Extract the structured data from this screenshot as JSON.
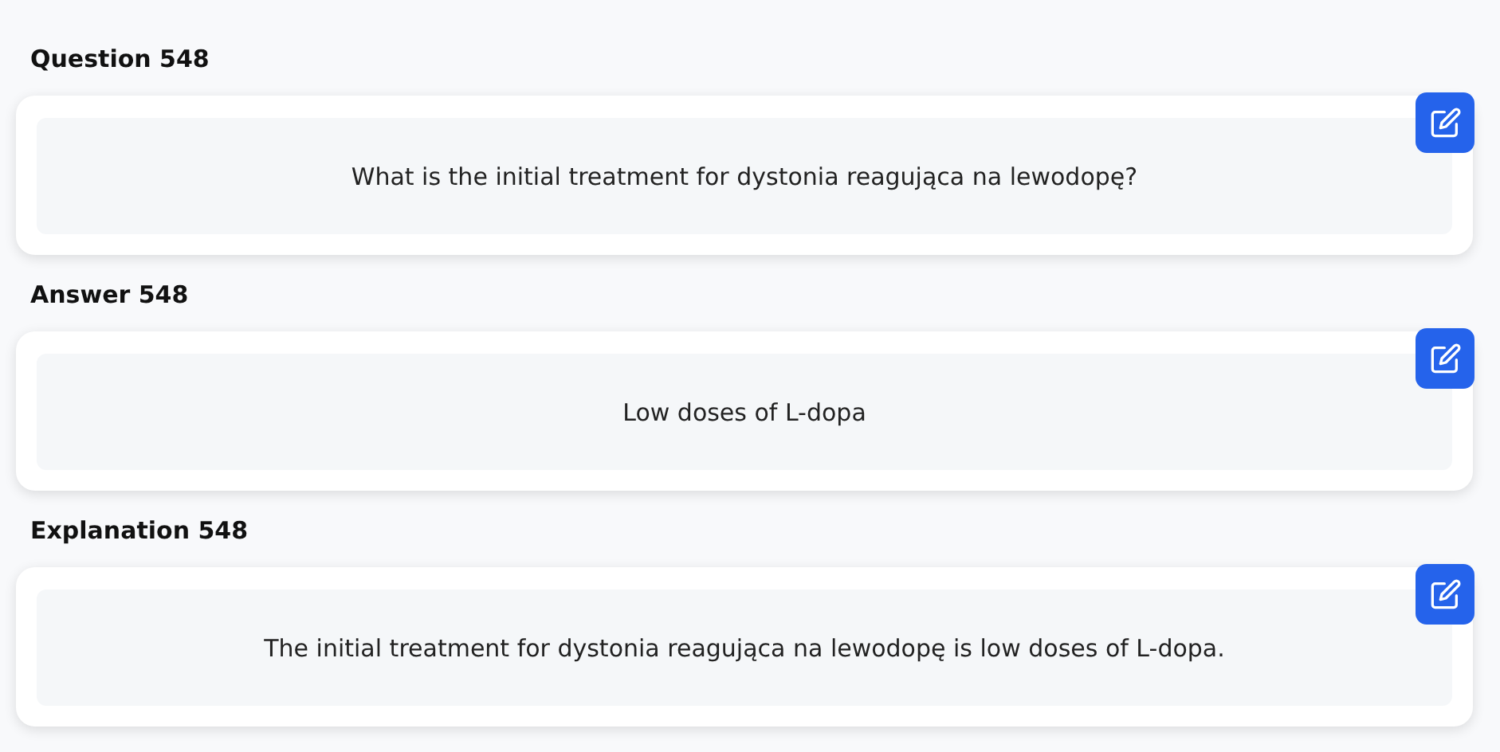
{
  "sections": [
    {
      "heading": "Question 548",
      "text": "What is the initial treatment for dystonia reagująca na lewodopę?"
    },
    {
      "heading": "Answer 548",
      "text": "Low doses of L-dopa"
    },
    {
      "heading": "Explanation 548",
      "text": "The initial treatment for dystonia reagująca na lewodopę is low doses of L-dopa."
    }
  ]
}
